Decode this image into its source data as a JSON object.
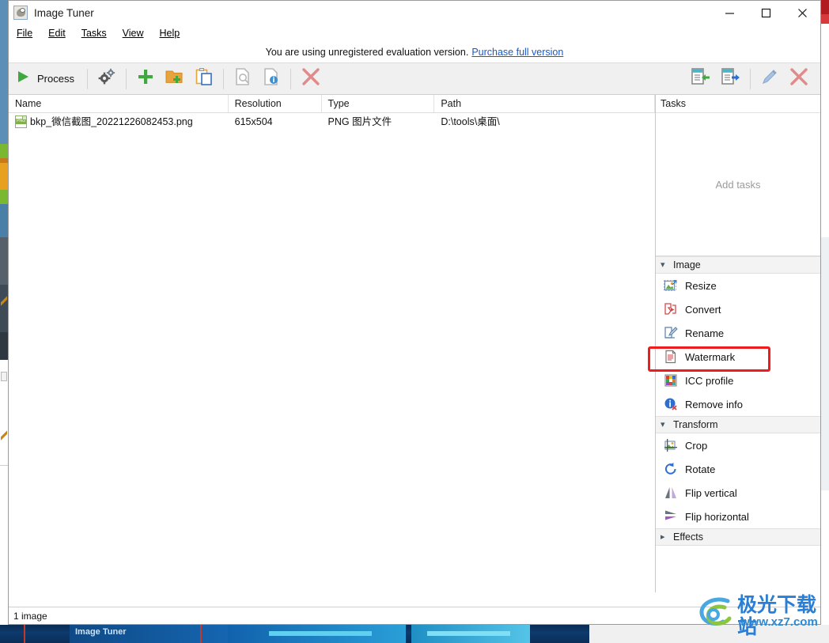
{
  "window": {
    "title": "Image Tuner",
    "app_icon": "camera-icon",
    "controls": {
      "minimize": "minimize-icon",
      "maximize": "maximize-icon",
      "close": "close-icon"
    }
  },
  "menubar": {
    "items": [
      {
        "label": "File",
        "accel": "F"
      },
      {
        "label": "Edit",
        "accel": "E"
      },
      {
        "label": "Tasks",
        "accel": "T"
      },
      {
        "label": "View",
        "accel": "V"
      },
      {
        "label": "Help",
        "accel": "H"
      }
    ]
  },
  "eval_banner": {
    "text": "You are using unregistered evaluation version.",
    "link": "Purchase full version"
  },
  "toolbar": {
    "process_label": "Process",
    "buttons": [
      {
        "name": "process-button",
        "icon": "play-icon",
        "label": "Process"
      },
      {
        "name": "settings-button",
        "icon": "gears-icon",
        "label": ""
      },
      {
        "name": "add-files-button",
        "icon": "plus-icon",
        "label": ""
      },
      {
        "name": "add-folder-button",
        "icon": "folder-add-icon",
        "label": ""
      },
      {
        "name": "paste-button",
        "icon": "clipboard-paste-icon",
        "label": ""
      },
      {
        "name": "preview-button",
        "icon": "document-search-icon",
        "label": ""
      },
      {
        "name": "info-button",
        "icon": "document-info-icon",
        "label": ""
      },
      {
        "name": "remove-button",
        "icon": "red-x-icon",
        "label": ""
      }
    ],
    "right_buttons": [
      {
        "name": "import-list-button",
        "icon": "import-arrow-icon"
      },
      {
        "name": "export-list-button",
        "icon": "export-arrow-icon"
      },
      {
        "name": "edit-task-button",
        "icon": "pencil-icon"
      },
      {
        "name": "delete-task-button",
        "icon": "red-x-icon"
      }
    ]
  },
  "filelist": {
    "columns": [
      "Name",
      "Resolution",
      "Type",
      "Path"
    ],
    "rows": [
      {
        "icon": "png-file-icon",
        "name": "bkp_微信截图_20221226082453.png",
        "resolution": "615x504",
        "type": "PNG 图片文件",
        "path": "D:\\tools\\桌面\\"
      }
    ]
  },
  "sidebar": {
    "tasks_header": "Tasks",
    "tasks_empty_text": "Add tasks",
    "groups": [
      {
        "name": "Image",
        "label": "Image",
        "expanded": true,
        "chevron": "chevron-down-icon",
        "items": [
          {
            "label": "Resize",
            "icon": "resize-icon",
            "highlighted": false
          },
          {
            "label": "Convert",
            "icon": "convert-icon",
            "highlighted": false
          },
          {
            "label": "Rename",
            "icon": "rename-icon",
            "highlighted": false
          },
          {
            "label": "Watermark",
            "icon": "watermark-icon",
            "highlighted": true
          },
          {
            "label": "ICC profile",
            "icon": "icc-profile-icon",
            "highlighted": false
          },
          {
            "label": "Remove info",
            "icon": "remove-info-icon",
            "highlighted": false
          }
        ]
      },
      {
        "name": "Transform",
        "label": "Transform",
        "expanded": true,
        "chevron": "chevron-down-icon",
        "items": [
          {
            "label": "Crop",
            "icon": "crop-icon",
            "highlighted": false
          },
          {
            "label": "Rotate",
            "icon": "rotate-icon",
            "highlighted": false
          },
          {
            "label": "Flip vertical",
            "icon": "flip-vertical-icon",
            "highlighted": false
          },
          {
            "label": "Flip horizontal",
            "icon": "flip-horizontal-icon",
            "highlighted": false
          }
        ]
      },
      {
        "name": "Effects",
        "label": "Effects",
        "expanded": false,
        "chevron": "chevron-right-icon",
        "items": []
      }
    ]
  },
  "statusbar": {
    "text": "1 image"
  },
  "taskbar": {
    "app_label": "Image Tuner"
  },
  "watermark": {
    "site_name_cn": "极光下载站",
    "site_url": "www.xz7.com"
  },
  "colors": {
    "highlight_red": "#ee1c1c",
    "link_blue": "#1a58c8",
    "toolbar_bg": "#f0f0f0",
    "group_header_bg": "#f3f3f3",
    "accent_green": "#3fa93f",
    "watermark_blue": "#2a7fd4"
  }
}
